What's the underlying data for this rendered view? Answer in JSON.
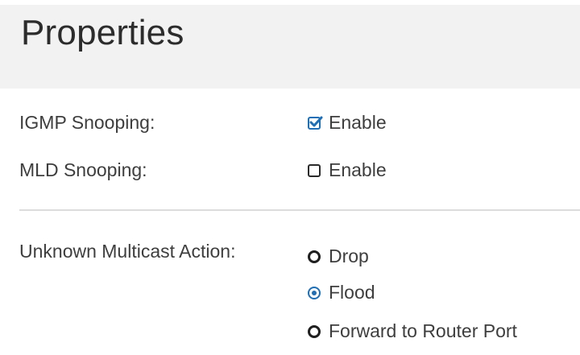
{
  "header": {
    "title": "Properties"
  },
  "igmp": {
    "label": "IGMP Snooping:",
    "option_label": "Enable",
    "checked": true
  },
  "mld": {
    "label": "MLD Snooping:",
    "option_label": "Enable",
    "checked": false
  },
  "unknown_multicast": {
    "label": "Unknown Multicast Action:",
    "options": [
      {
        "label": "Drop",
        "selected": false
      },
      {
        "label": "Flood",
        "selected": true
      },
      {
        "label": "Forward to Router Port",
        "selected": false
      }
    ]
  },
  "colors": {
    "accent": "#1e6fb5",
    "header_bg": "#f2f2f2",
    "divider": "#dcdcdc"
  }
}
